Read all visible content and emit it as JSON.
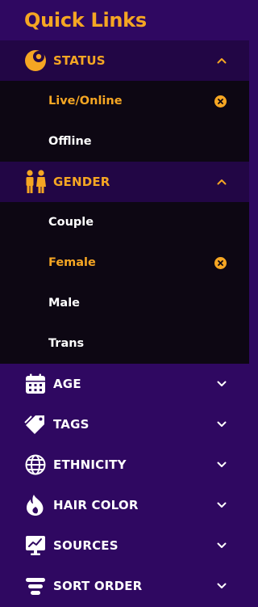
{
  "title": "Quick Links",
  "colors": {
    "accent": "#f5a623",
    "panel": "#2f0861",
    "open_header": "#220645",
    "options_bg": "#0d0713"
  },
  "status": {
    "label": "STATUS",
    "icon": "moon-status-icon",
    "expanded": true,
    "options": [
      {
        "label": "Live/Online",
        "selected": true
      },
      {
        "label": "Offline",
        "selected": false
      }
    ]
  },
  "gender": {
    "label": "GENDER",
    "icon": "people-icon",
    "expanded": true,
    "options": [
      {
        "label": "Couple",
        "selected": false
      },
      {
        "label": "Female",
        "selected": true
      },
      {
        "label": "Male",
        "selected": false
      },
      {
        "label": "Trans",
        "selected": false
      }
    ]
  },
  "age": {
    "label": "AGE",
    "icon": "calendar-icon"
  },
  "tags": {
    "label": "TAGS",
    "icon": "tags-icon"
  },
  "ethnicity": {
    "label": "ETHNICITY",
    "icon": "globe-icon"
  },
  "hair_color": {
    "label": "HAIR COLOR",
    "icon": "flame-icon"
  },
  "sources": {
    "label": "SOURCES",
    "icon": "monitor-chart-icon"
  },
  "sort_order": {
    "label": "SORT ORDER",
    "icon": "sort-icon"
  }
}
